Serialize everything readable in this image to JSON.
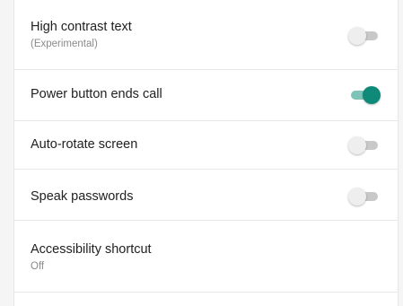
{
  "settings": [
    {
      "title": "High contrast text",
      "subtitle": "(Experimental)",
      "toggle": "off"
    },
    {
      "title": "Power button ends call",
      "toggle": "on"
    },
    {
      "title": "Auto-rotate screen",
      "toggle": "off"
    },
    {
      "title": "Speak passwords",
      "toggle": "off"
    },
    {
      "title": "Accessibility shortcut",
      "subtitle": "Off"
    }
  ],
  "colors": {
    "accent": "#0f8a78",
    "accent_track": "#7dc3b8",
    "toggle_off_thumb": "#eeeeee",
    "toggle_off_track": "#c8c8c8",
    "divider": "#e8e8e8",
    "title_text": "#212121",
    "subtitle_text": "#8a8a8a"
  },
  "icons": {
    "toggle_on": "toggle-on-icon",
    "toggle_off": "toggle-off-icon"
  }
}
